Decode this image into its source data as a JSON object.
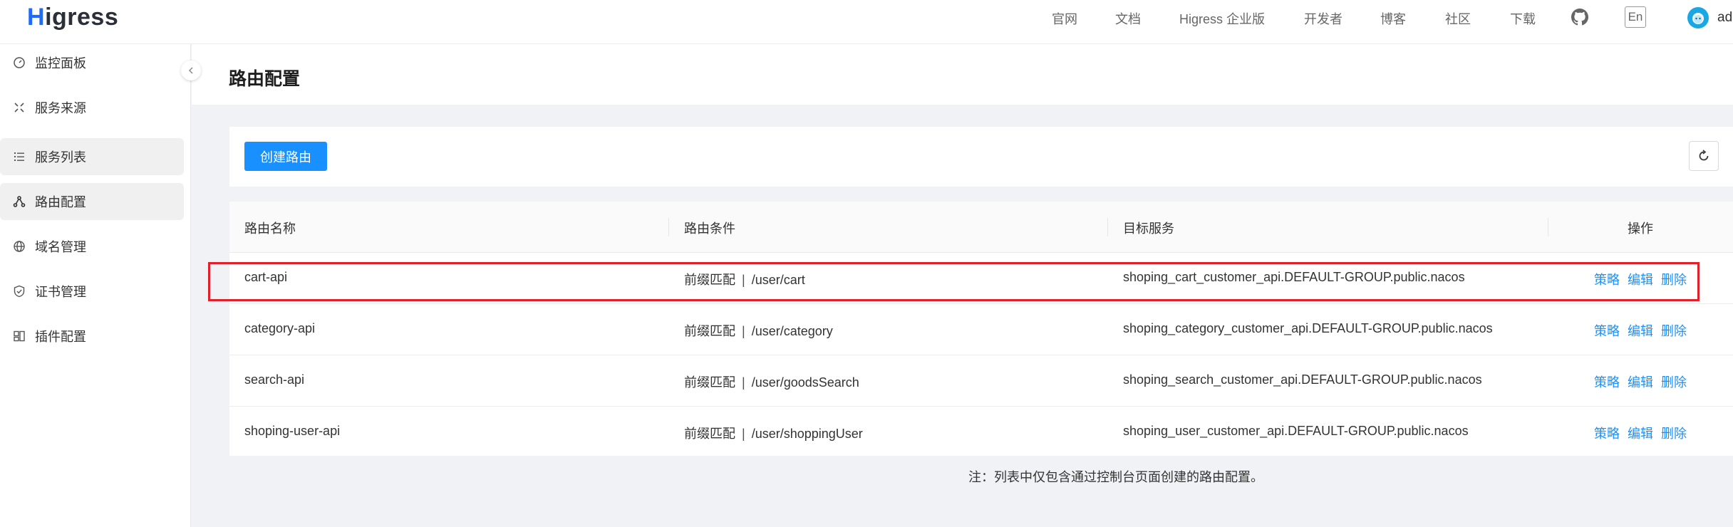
{
  "header": {
    "logo_text": "igress",
    "logo_mark": "H",
    "nav": [
      "官网",
      "文档",
      "Higress 企业版",
      "开发者",
      "博客",
      "社区",
      "下载"
    ],
    "lang_label": "En",
    "user_name": "ad"
  },
  "sidebar": {
    "items": [
      {
        "label": "监控面板",
        "icon": "dashboard-icon"
      },
      {
        "label": "服务来源",
        "icon": "service-source-icon"
      },
      {
        "label": "服务列表",
        "icon": "list-icon"
      },
      {
        "label": "路由配置",
        "icon": "route-icon"
      },
      {
        "label": "域名管理",
        "icon": "globe-icon"
      },
      {
        "label": "证书管理",
        "icon": "shield-icon"
      },
      {
        "label": "插件配置",
        "icon": "plugin-icon"
      }
    ]
  },
  "page": {
    "title": "路由配置",
    "create_button": "创建路由"
  },
  "table": {
    "columns": [
      "路由名称",
      "路由条件",
      "目标服务",
      "操作"
    ],
    "condition_separator": "|",
    "actions": [
      "策略",
      "编辑",
      "删除"
    ],
    "rows": [
      {
        "name": "cart-api",
        "match_type": "前缀匹配",
        "path": "/user/cart",
        "service": "shoping_cart_customer_api.DEFAULT-GROUP.public.nacos"
      },
      {
        "name": "category-api",
        "match_type": "前缀匹配",
        "path": "/user/category",
        "service": "shoping_category_customer_api.DEFAULT-GROUP.public.nacos"
      },
      {
        "name": "search-api",
        "match_type": "前缀匹配",
        "path": "/user/goodsSearch",
        "service": "shoping_search_customer_api.DEFAULT-GROUP.public.nacos"
      },
      {
        "name": "shoping-user-api",
        "match_type": "前缀匹配",
        "path": "/user/shoppingUser",
        "service": "shoping_user_customer_api.DEFAULT-GROUP.public.nacos"
      }
    ]
  },
  "footnote": "注：列表中仅包含通过控制台页面创建的路由配置。",
  "colors": {
    "primary": "#1890ff",
    "highlight": "#e0202b",
    "brand": "#1f6cf5"
  }
}
